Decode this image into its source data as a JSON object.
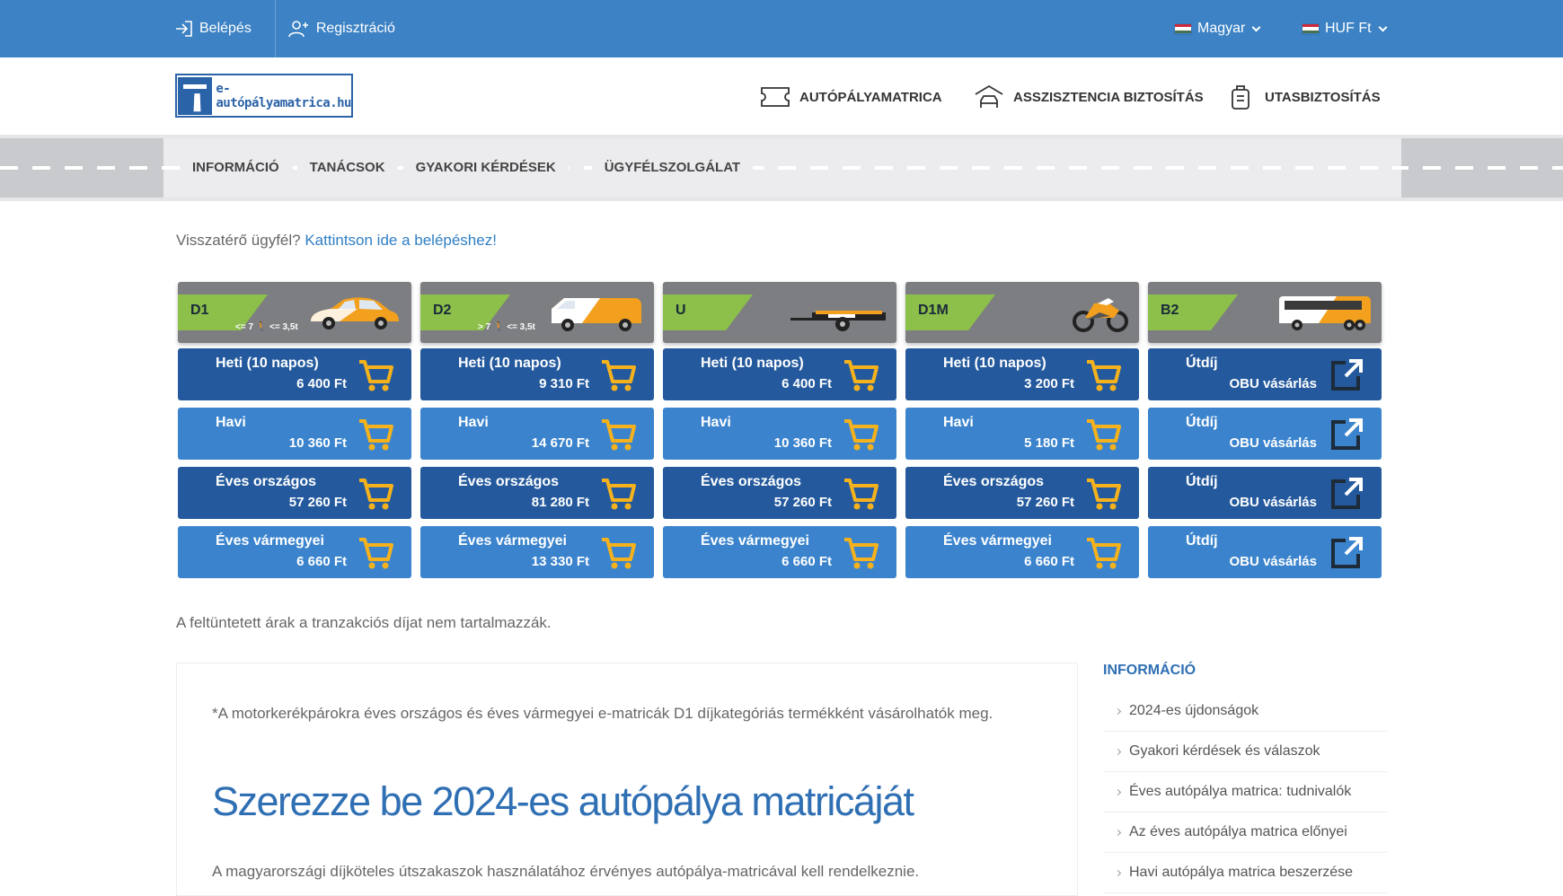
{
  "topbar": {
    "login": "Belépés",
    "register": "Regisztráció",
    "language": "Magyar",
    "currency": "HUF Ft"
  },
  "header": {
    "logo_text": "e-autópályamatrica.hu",
    "nav": [
      {
        "label": "AUTÓPÁLYAMATRICA",
        "icon": "ticket-icon"
      },
      {
        "label": "ASSZISZTENCIA BIZTOSÍTÁS",
        "icon": "garage-car-icon"
      },
      {
        "label": "UTASBIZTOSÍTÁS",
        "icon": "luggage-icon"
      }
    ]
  },
  "subnav": [
    "INFORMÁCIÓ",
    "TANÁCSOK",
    "GYAKORI KÉRDÉSEK",
    "ÜGYFÉLSZOLGÁLAT"
  ],
  "returning": {
    "text": "Visszatérő ügyfél?",
    "link": "Kattintson ide a belépéshez!"
  },
  "categories": [
    {
      "code": "D1",
      "note": "<= 7 🚶 <= 3,5t",
      "vehicle": "car-icon",
      "items": [
        {
          "label": "Heti (10 napos)",
          "price": "6 400 Ft"
        },
        {
          "label": "Havi",
          "price": "10 360 Ft"
        },
        {
          "label": "Éves országos",
          "price": "57 260 Ft"
        },
        {
          "label": "Éves vármegyei",
          "price": "6 660 Ft"
        }
      ]
    },
    {
      "code": "D2",
      "note": "> 7 🚶 <= 3,5t",
      "vehicle": "van-icon",
      "items": [
        {
          "label": "Heti (10 napos)",
          "price": "9 310 Ft"
        },
        {
          "label": "Havi",
          "price": "14 670 Ft"
        },
        {
          "label": "Éves országos",
          "price": "81 280 Ft"
        },
        {
          "label": "Éves vármegyei",
          "price": "13 330 Ft"
        }
      ]
    },
    {
      "code": "U",
      "note": "",
      "vehicle": "trailer-icon",
      "items": [
        {
          "label": "Heti (10 napos)",
          "price": "6 400 Ft"
        },
        {
          "label": "Havi",
          "price": "10 360 Ft"
        },
        {
          "label": "Éves országos",
          "price": "57 260 Ft"
        },
        {
          "label": "Éves vármegyei",
          "price": "6 660 Ft"
        }
      ]
    },
    {
      "code": "D1M",
      "note": "",
      "vehicle": "motorcycle-icon",
      "items": [
        {
          "label": "Heti (10 napos)",
          "price": "3 200 Ft"
        },
        {
          "label": "Havi",
          "price": "5 180 Ft"
        },
        {
          "label": "Éves országos",
          "price": "57 260 Ft"
        },
        {
          "label": "Éves vármegyei",
          "price": "6 660 Ft"
        }
      ]
    },
    {
      "code": "B2",
      "note": "",
      "vehicle": "bus-icon",
      "items": [
        {
          "label": "Útdíj",
          "price": "OBU vásárlás"
        },
        {
          "label": "Útdíj",
          "price": "OBU vásárlás"
        },
        {
          "label": "Útdíj",
          "price": "OBU vásárlás"
        },
        {
          "label": "Útdíj",
          "price": "OBU vásárlás"
        }
      ]
    }
  ],
  "price_note": "A feltüntetett árak a tranzakciós díjat nem tartalmazzák.",
  "content": {
    "note": "*A motorkerékpárokra éves országos és éves vármegyei e-matricák D1 díjkategóriás termékként vásárolhatók meg.",
    "title": "Szerezze be 2024-es autópálya matricáját",
    "para": "A magyarországi díjköteles útszakaszok használatához érvényes autópálya-matricával kell rendelkeznie."
  },
  "sidebar": {
    "title": "INFORMÁCIÓ",
    "items": [
      "2024-es újdonságok",
      "Gyakori kérdések és válaszok",
      "Éves autópálya matrica: tudnivalók",
      "Az éves autópálya matrica előnyei",
      "Havi autópálya matrica beszerzése"
    ]
  },
  "colors": {
    "topbar": "#3c82c4",
    "button_dark": "#245a9d",
    "button_light": "#3b84cd",
    "category_tab": "#8cc04a",
    "cart_icon": "#f5b21c",
    "heading": "#2f6fb3"
  }
}
